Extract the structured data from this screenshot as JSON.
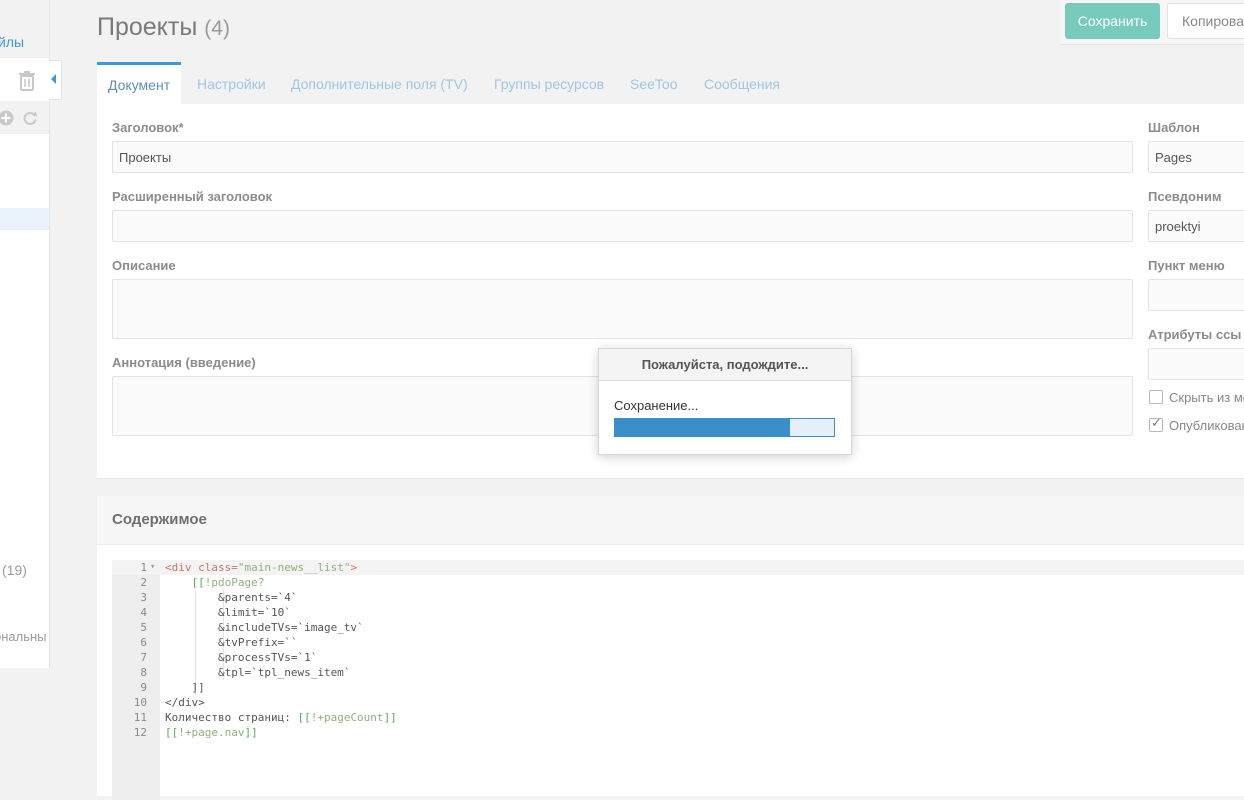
{
  "sidebar": {
    "files_link": "йлы",
    "count": "(19)",
    "additional": "ональны",
    "icons": [
      "trash-icon",
      "plus-circle-icon",
      "refresh-icon",
      "collapse-arrow-icon"
    ]
  },
  "header": {
    "title": "Проекты",
    "count": "(4)",
    "save_label": "Сохранить",
    "copy_label": "Копироват"
  },
  "tabs": [
    {
      "label": "Документ",
      "active": true
    },
    {
      "label": "Настройки"
    },
    {
      "label": "Дополнительные поля (TV)"
    },
    {
      "label": "Группы ресурсов"
    },
    {
      "label": "SeeToo"
    },
    {
      "label": "Сообщения"
    }
  ],
  "form": {
    "pagetitle": {
      "label": "Заголовок*",
      "value": "Проекты"
    },
    "longtitle": {
      "label": "Расширенный заголовок",
      "value": ""
    },
    "description": {
      "label": "Описание",
      "value": ""
    },
    "introtext": {
      "label": "Аннотация (введение)",
      "value": ""
    },
    "template": {
      "label": "Шаблон",
      "value": "Pages"
    },
    "alias": {
      "label": "Псевдоним",
      "value": "proektyi"
    },
    "menutitle": {
      "label": "Пункт меню",
      "value": ""
    },
    "link_attributes": {
      "label": "Атрибуты ссы",
      "value": ""
    },
    "hide_menu": {
      "label": "Скрыть из ме",
      "checked": false
    },
    "published": {
      "label": "Опубликован",
      "checked": true
    }
  },
  "content": {
    "title": "Содержимое",
    "lines": [
      {
        "n": "1",
        "fold": true
      },
      {
        "n": "2"
      },
      {
        "n": "3"
      },
      {
        "n": "4"
      },
      {
        "n": "5"
      },
      {
        "n": "6"
      },
      {
        "n": "7"
      },
      {
        "n": "8"
      },
      {
        "n": "9"
      },
      {
        "n": "10"
      },
      {
        "n": "11"
      },
      {
        "n": "12"
      }
    ],
    "code": {
      "l1a": "<div ",
      "l1b": "class=",
      "l1c": "\"main-news__list\"",
      "l1d": ">",
      "l2a": "    [[",
      "l2b": "!pdoPage?",
      "l3": "        &parents=`4`",
      "l4": "        &limit=`10`",
      "l5": "        &includeTVs=`image_tv`",
      "l6": "        &tvPrefix=``",
      "l7": "        &processTVs=`1`",
      "l8": "        &tpl=`tpl_news_item`",
      "l9": "    ]]",
      "l10": "</div>",
      "l11a": "Количество страниц: ",
      "l11b": "[[",
      "l11c": "!+pageCount",
      "l11d": "]]",
      "l12a": "[[",
      "l12b": "!+page.nav",
      "l12c": "]]"
    }
  },
  "modal": {
    "title": "Пожалуйста, подождите...",
    "message": "Сохранение...",
    "progress": 0.8
  },
  "colors": {
    "accent": "#3c9ad6",
    "save": "#77cbbd",
    "progress": "#3a8fc8"
  }
}
